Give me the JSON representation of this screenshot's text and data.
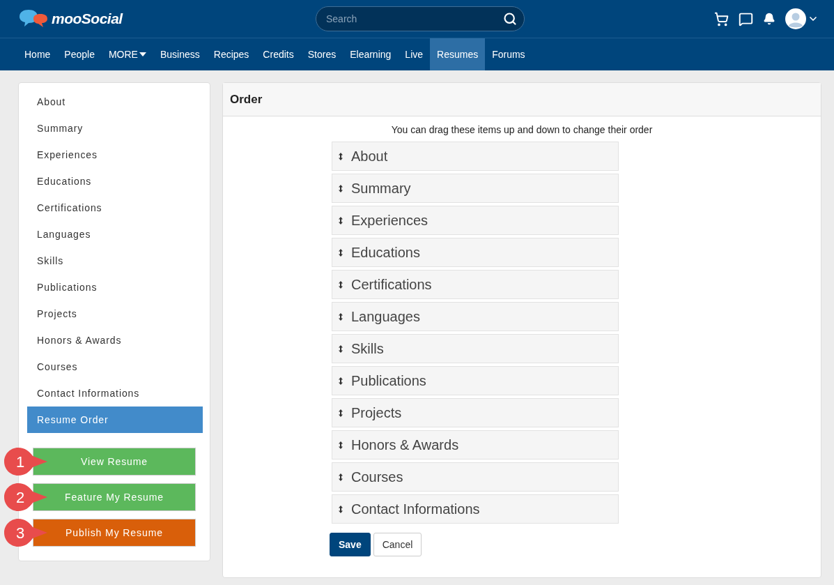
{
  "header": {
    "logo": "mooSocial",
    "search": {
      "placeholder": "Search"
    }
  },
  "nav": [
    {
      "label": "Home",
      "kind": "link",
      "selected": false
    },
    {
      "label": "People",
      "kind": "link",
      "selected": false
    },
    {
      "label": "MORE",
      "kind": "dropdown",
      "selected": false
    },
    {
      "label": "Business",
      "kind": "link",
      "selected": false
    },
    {
      "label": "Recipes",
      "kind": "link",
      "selected": false
    },
    {
      "label": "Credits",
      "kind": "link",
      "selected": false
    },
    {
      "label": "Stores",
      "kind": "link",
      "selected": false
    },
    {
      "label": "Elearning",
      "kind": "link",
      "selected": false
    },
    {
      "label": "Live",
      "kind": "link",
      "selected": false
    },
    {
      "label": "Resumes",
      "kind": "link",
      "selected": true
    },
    {
      "label": "Forums",
      "kind": "link",
      "selected": false
    }
  ],
  "sidebar": {
    "items": [
      {
        "label": "About",
        "selected": false
      },
      {
        "label": "Summary",
        "selected": false
      },
      {
        "label": "Experiences",
        "selected": false
      },
      {
        "label": "Educations",
        "selected": false
      },
      {
        "label": "Certifications",
        "selected": false
      },
      {
        "label": "Languages",
        "selected": false
      },
      {
        "label": "Skills",
        "selected": false
      },
      {
        "label": "Publications",
        "selected": false
      },
      {
        "label": "Projects",
        "selected": false
      },
      {
        "label": "Honors & Awards",
        "selected": false
      },
      {
        "label": "Courses",
        "selected": false
      },
      {
        "label": "Contact Informations",
        "selected": false
      },
      {
        "label": "Resume Order",
        "selected": true
      }
    ],
    "actions": [
      {
        "marker": "1",
        "label": "View Resume",
        "kind": "success"
      },
      {
        "marker": "2",
        "label": "Feature My Resume",
        "kind": "success"
      },
      {
        "marker": "3",
        "label": "Publish My Resume",
        "kind": "warning"
      }
    ]
  },
  "order": {
    "title": "Order",
    "hint": "You can drag these items up and down to change their order",
    "items": [
      "About",
      "Summary",
      "Experiences",
      "Educations",
      "Certifications",
      "Languages",
      "Skills",
      "Publications",
      "Projects",
      "Honors & Awards",
      "Courses",
      "Contact Informations"
    ],
    "buttons": [
      {
        "label": "Save",
        "kind": "primary"
      },
      {
        "label": "Cancel",
        "kind": "default"
      }
    ]
  }
}
